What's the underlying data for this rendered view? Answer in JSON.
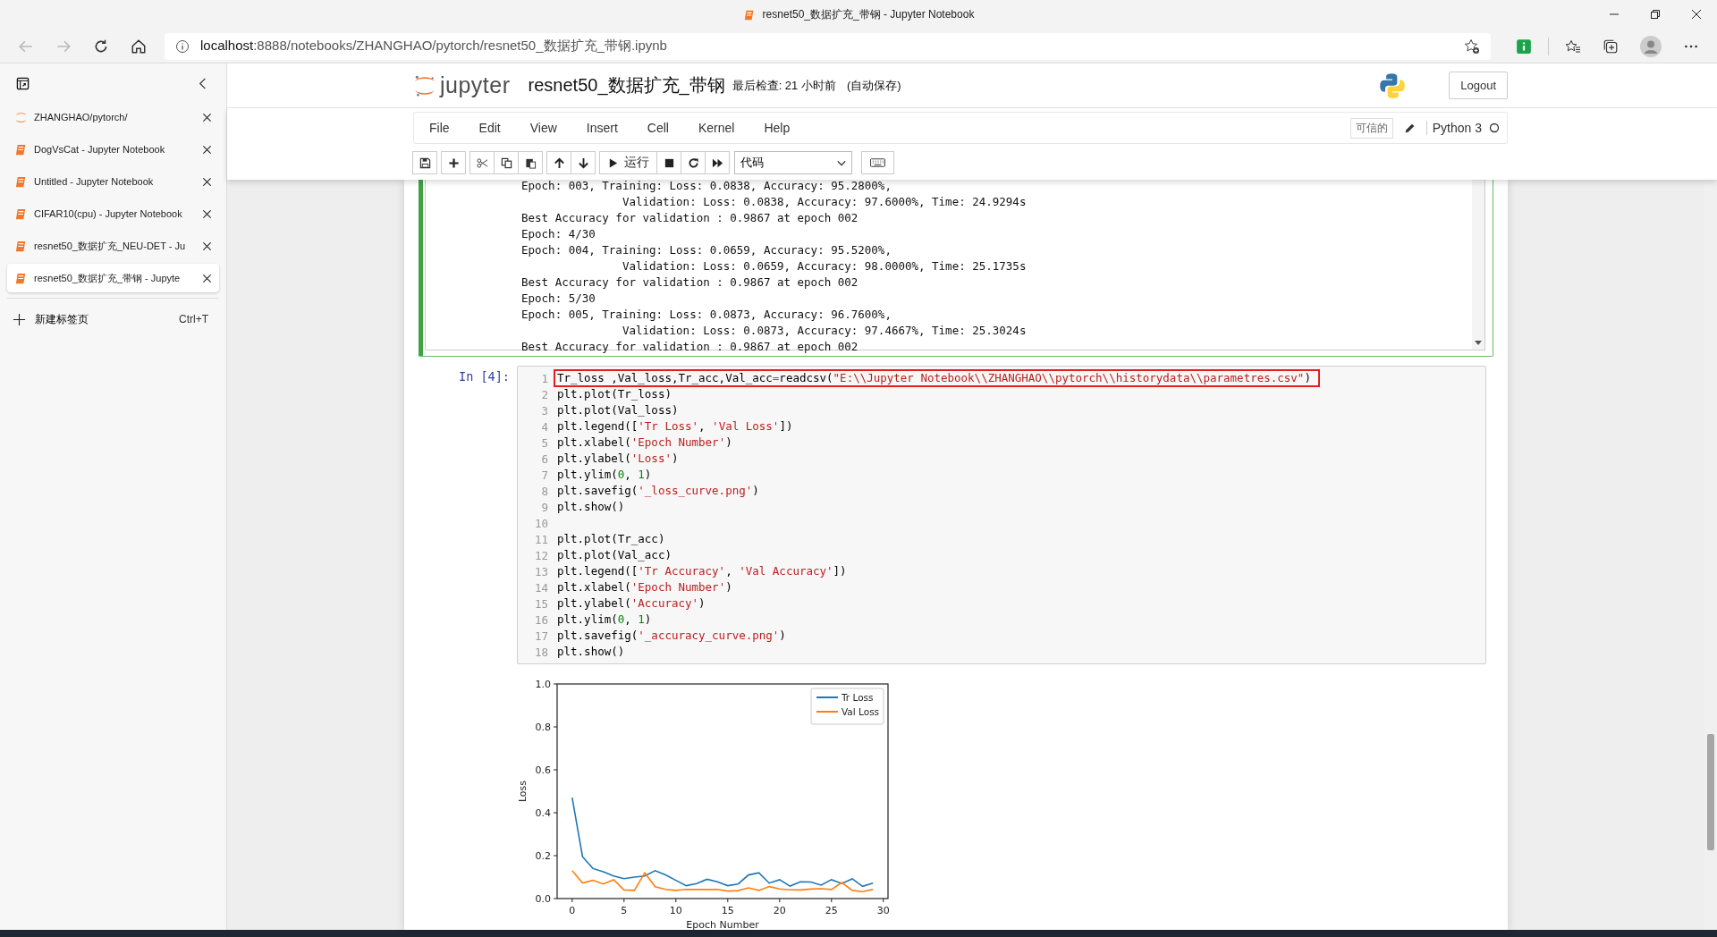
{
  "browser": {
    "tab_title": "resnet50_数据扩充_带钢 - Jupyter Notebook",
    "url_host": "localhost",
    "url_rest": ":8888/notebooks/ZHANGHAO/pytorch/resnet50_数据扩充_带钢.ipynb"
  },
  "sidebar": {
    "tabs": [
      {
        "title": "ZHANGHAO/pytorch/",
        "kind": "jupyter",
        "selected": false
      },
      {
        "title": "DogVsCat - Jupyter Notebook",
        "kind": "notebook",
        "selected": false
      },
      {
        "title": "Untitled - Jupyter Notebook",
        "kind": "notebook",
        "selected": false
      },
      {
        "title": "CIFAR10(cpu) - Jupyter Notebook",
        "kind": "notebook",
        "selected": false
      },
      {
        "title": "resnet50_数据扩充_NEU-DET - Ju",
        "kind": "notebook",
        "selected": false
      },
      {
        "title": "resnet50_数据扩充_带钢 - Jupyte",
        "kind": "notebook",
        "selected": true
      }
    ],
    "new_tab": {
      "label": "新建标签页",
      "shortcut": "Ctrl+T"
    }
  },
  "header": {
    "logo": "jupyter",
    "notebook_name": "resnet50_数据扩充_带钢",
    "checkpoint": "最后检查: 21 小时前",
    "autosave": "(自动保存)",
    "logout": "Logout"
  },
  "menu": [
    "File",
    "Edit",
    "View",
    "Insert",
    "Cell",
    "Kernel",
    "Help"
  ],
  "kernel": {
    "trusted": "可信的",
    "name": "Python 3",
    "busy": false
  },
  "toolbar": {
    "run_label": "运行",
    "cell_type": "代码"
  },
  "output_cell": {
    "selected": true,
    "lines": [
      "Epoch: 003, Training: Loss: 0.0838, Accuracy: 95.2800%,",
      "               Validation: Loss: 0.0838, Accuracy: 97.6000%, Time: 24.9294s",
      "Best Accuracy for validation : 0.9867 at epoch 002",
      "Epoch: 4/30",
      "Epoch: 004, Training: Loss: 0.0659, Accuracy: 95.5200%,",
      "               Validation: Loss: 0.0659, Accuracy: 98.0000%, Time: 25.1735s",
      "Best Accuracy for validation : 0.9867 at epoch 002",
      "Epoch: 5/30",
      "Epoch: 005, Training: Loss: 0.0873, Accuracy: 96.7600%,",
      "               Validation: Loss: 0.0873, Accuracy: 97.4667%, Time: 25.3024s",
      "Best Accuracy for validation : 0.9867 at epoch 002"
    ]
  },
  "code_cell": {
    "prompt": "In [4]:",
    "lines": [
      {
        "number": "1",
        "highlighted": true,
        "tokens": [
          {
            "kind": "plain",
            "text": "Tr_loss ,Val_loss,Tr_acc,Val_acc"
          },
          {
            "kind": "op",
            "text": "="
          },
          {
            "kind": "plain",
            "text": "readcsv("
          },
          {
            "kind": "string",
            "text": "\"E:\\\\Jupyter Notebook\\\\ZHANGHAO\\\\pytorch\\\\historydata\\\\parametres.csv\""
          },
          {
            "kind": "plain",
            "text": ")"
          }
        ]
      },
      {
        "number": "2",
        "highlighted": false,
        "tokens": [
          {
            "kind": "plain",
            "text": "plt.plot(Tr_loss)"
          }
        ]
      },
      {
        "number": "3",
        "highlighted": false,
        "tokens": [
          {
            "kind": "plain",
            "text": "plt.plot(Val_loss)"
          }
        ]
      },
      {
        "number": "4",
        "highlighted": false,
        "tokens": [
          {
            "kind": "plain",
            "text": "plt.legend(["
          },
          {
            "kind": "string",
            "text": "'Tr Loss'"
          },
          {
            "kind": "plain",
            "text": ", "
          },
          {
            "kind": "string",
            "text": "'Val Loss'"
          },
          {
            "kind": "plain",
            "text": "])"
          }
        ]
      },
      {
        "number": "5",
        "highlighted": false,
        "tokens": [
          {
            "kind": "plain",
            "text": "plt.xlabel("
          },
          {
            "kind": "string",
            "text": "'Epoch Number'"
          },
          {
            "kind": "plain",
            "text": ")"
          }
        ]
      },
      {
        "number": "6",
        "highlighted": false,
        "tokens": [
          {
            "kind": "plain",
            "text": "plt.ylabel("
          },
          {
            "kind": "string",
            "text": "'Loss'"
          },
          {
            "kind": "plain",
            "text": ")"
          }
        ]
      },
      {
        "number": "7",
        "highlighted": false,
        "tokens": [
          {
            "kind": "plain",
            "text": "plt.ylim("
          },
          {
            "kind": "number",
            "text": "0"
          },
          {
            "kind": "plain",
            "text": ", "
          },
          {
            "kind": "number",
            "text": "1"
          },
          {
            "kind": "plain",
            "text": ")"
          }
        ]
      },
      {
        "number": "8",
        "highlighted": false,
        "tokens": [
          {
            "kind": "plain",
            "text": "plt.savefig("
          },
          {
            "kind": "string",
            "text": "'_loss_curve.png'"
          },
          {
            "kind": "plain",
            "text": ")"
          }
        ]
      },
      {
        "number": "9",
        "highlighted": false,
        "tokens": [
          {
            "kind": "plain",
            "text": "plt.show()"
          }
        ]
      },
      {
        "number": "10",
        "highlighted": false
      },
      {
        "number": "11",
        "highlighted": false,
        "tokens": [
          {
            "kind": "plain",
            "text": "plt.plot(Tr_acc)"
          }
        ]
      },
      {
        "number": "12",
        "highlighted": false,
        "tokens": [
          {
            "kind": "plain",
            "text": "plt.plot(Val_acc)"
          }
        ]
      },
      {
        "number": "13",
        "highlighted": false,
        "tokens": [
          {
            "kind": "plain",
            "text": "plt.legend(["
          },
          {
            "kind": "string",
            "text": "'Tr Accuracy'"
          },
          {
            "kind": "plain",
            "text": ", "
          },
          {
            "kind": "string",
            "text": "'Val Accuracy'"
          },
          {
            "kind": "plain",
            "text": "])"
          }
        ]
      },
      {
        "number": "14",
        "highlighted": false,
        "tokens": [
          {
            "kind": "plain",
            "text": "plt.xlabel("
          },
          {
            "kind": "string",
            "text": "'Epoch Number'"
          },
          {
            "kind": "plain",
            "text": ")"
          }
        ]
      },
      {
        "number": "15",
        "highlighted": false,
        "tokens": [
          {
            "kind": "plain",
            "text": "plt.ylabel("
          },
          {
            "kind": "string",
            "text": "'Accuracy'"
          },
          {
            "kind": "plain",
            "text": ")"
          }
        ]
      },
      {
        "number": "16",
        "highlighted": false,
        "tokens": [
          {
            "kind": "plain",
            "text": "plt.ylim("
          },
          {
            "kind": "number",
            "text": "0"
          },
          {
            "kind": "plain",
            "text": ", "
          },
          {
            "kind": "number",
            "text": "1"
          },
          {
            "kind": "plain",
            "text": ")"
          }
        ]
      },
      {
        "number": "17",
        "highlighted": false,
        "tokens": [
          {
            "kind": "plain",
            "text": "plt.savefig("
          },
          {
            "kind": "string",
            "text": "'_accuracy_curve.png'"
          },
          {
            "kind": "plain",
            "text": ")"
          }
        ]
      },
      {
        "number": "18",
        "highlighted": false,
        "tokens": [
          {
            "kind": "plain",
            "text": "plt.show()"
          }
        ]
      }
    ]
  },
  "plot": {
    "chart_data": {
      "type": "line",
      "xlabel": "Epoch Number",
      "ylabel": "Loss",
      "x": [
        0,
        1,
        2,
        3,
        4,
        5,
        6,
        7,
        8,
        9,
        10,
        11,
        12,
        13,
        14,
        15,
        16,
        17,
        18,
        19,
        20,
        21,
        22,
        23,
        24,
        25,
        26,
        27,
        28,
        29
      ],
      "xlim": [
        -1.45,
        30.45
      ],
      "ylim": [
        0,
        1
      ],
      "xticks": [
        {
          "value": 0,
          "label": "0"
        },
        {
          "value": 5,
          "label": "5"
        },
        {
          "value": 10,
          "label": "10"
        },
        {
          "value": 15,
          "label": "15"
        },
        {
          "value": 20,
          "label": "20"
        },
        {
          "value": 25,
          "label": "25"
        },
        {
          "value": 30,
          "label": "30"
        }
      ],
      "legend": "upper right",
      "yticks": [
        {
          "value": 0,
          "label": "0.0"
        },
        {
          "value": 0.2,
          "label": "0.2"
        },
        {
          "value": 0.4,
          "label": "0.4"
        },
        {
          "value": 0.6,
          "label": "0.6"
        },
        {
          "value": 0.8,
          "label": "0.8"
        },
        {
          "value": 1,
          "label": "1.0"
        }
      ],
      "series": [
        {
          "name": "Tr Loss",
          "color": "#1f77b4",
          "values": [
            0.47,
            0.195,
            0.14,
            0.125,
            0.105,
            0.093,
            0.1,
            0.105,
            0.13,
            0.11,
            0.085,
            0.06,
            0.07,
            0.09,
            0.078,
            0.06,
            0.068,
            0.11,
            0.12,
            0.072,
            0.088,
            0.058,
            0.078,
            0.077,
            0.063,
            0.088,
            0.07,
            0.092,
            0.057,
            0.072
          ]
        },
        {
          "name": "Val Loss",
          "color": "#ff7f0e",
          "values": [
            0.13,
            0.073,
            0.085,
            0.068,
            0.088,
            0.04,
            0.038,
            0.12,
            0.055,
            0.043,
            0.038,
            0.043,
            0.042,
            0.042,
            0.043,
            0.035,
            0.037,
            0.05,
            0.038,
            0.056,
            0.045,
            0.041,
            0.04,
            0.044,
            0.046,
            0.042,
            0.075,
            0.038,
            0.032,
            0.042
          ]
        }
      ]
    }
  }
}
